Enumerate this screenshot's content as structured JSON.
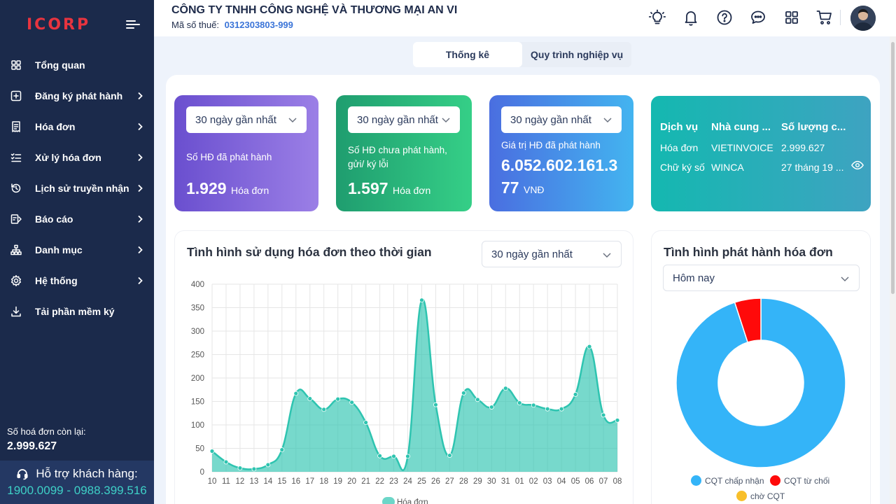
{
  "sidebar": {
    "logo": "ICORP",
    "items": [
      {
        "label": "Tổng quan",
        "icon": "grid-icon",
        "chevron": false
      },
      {
        "label": "Đăng ký phát hành",
        "icon": "plus-square-icon",
        "chevron": true
      },
      {
        "label": "Hóa đơn",
        "icon": "receipt-icon",
        "chevron": true
      },
      {
        "label": "Xử lý hóa đơn",
        "icon": "checklist-icon",
        "chevron": true
      },
      {
        "label": "Lịch sử truyền nhận",
        "icon": "history-icon",
        "chevron": true
      },
      {
        "label": "Báo cáo",
        "icon": "report-icon",
        "chevron": true
      },
      {
        "label": "Danh mục",
        "icon": "sitemap-icon",
        "chevron": true
      },
      {
        "label": "Hệ thống",
        "icon": "gear-icon",
        "chevron": true
      },
      {
        "label": "Tải phần mềm ký",
        "icon": "download-icon",
        "chevron": false
      }
    ],
    "remaining_label": "Số hoá đơn còn lại:",
    "remaining_value": "2.999.627",
    "support_label": "Hỗ trợ khách hàng:",
    "support_phones": "1900.0099 - 0988.399.516"
  },
  "header": {
    "company": "CÔNG TY TNHH CÔNG NGHỆ VÀ THƯƠNG MẠI AN VI",
    "tax_label": "Mã số thuế:",
    "tax_code": "0312303803-999",
    "icons": [
      "lightbulb-icon",
      "bell-icon",
      "help-icon",
      "chat-icon",
      "apps-icon",
      "cart-icon"
    ]
  },
  "tabs": [
    {
      "label": "Thống kê",
      "active": true
    },
    {
      "label": "Quy trình nghiệp vụ",
      "active": false
    }
  ],
  "cards": [
    {
      "period": "30 ngày gần nhất",
      "label": "Số HĐ đã phát hành",
      "value": "1.929",
      "unit": "Hóa đơn",
      "gradient": [
        "#6a4fcf",
        "#9b7fe6"
      ]
    },
    {
      "period": "30 ngày gần nhất",
      "label": "Số HĐ chưa phát hành, gửi/ ký lỗi",
      "value": "1.597",
      "unit": "Hóa đơn",
      "gradient": [
        "#1f9d6f",
        "#35cf87"
      ]
    },
    {
      "period": "30 ngày gần nhất",
      "label": "Giá trị HĐ đã phát hành",
      "value": "6.052.602.161.377",
      "unit": "VNĐ",
      "gradient": [
        "#4a6ee0",
        "#43b4f0"
      ]
    }
  ],
  "service": {
    "headers": [
      "Dịch vụ",
      "Nhà cung ...",
      "Số lượng c..."
    ],
    "rows": [
      [
        "Hóa đơn",
        "VIETINVOICE",
        "2.999.627"
      ],
      [
        "Chữ ký số",
        "WINCA",
        "27 tháng 19 ..."
      ]
    ],
    "icon": "eye-icon"
  },
  "usage_chart": {
    "title": "Tình hình sử dụng hóa đơn theo thời gian",
    "period": "30 ngày gần nhất"
  },
  "chart_data": [
    {
      "type": "area",
      "title": "Tình hình sử dụng hóa đơn theo thời gian",
      "categories": [
        "10",
        "11",
        "12",
        "13",
        "14",
        "15",
        "16",
        "17",
        "18",
        "19",
        "20",
        "21",
        "22",
        "23",
        "24",
        "25",
        "26",
        "27",
        "28",
        "29",
        "30",
        "31",
        "01",
        "02",
        "03",
        "04",
        "05",
        "06",
        "07",
        "08"
      ],
      "series": [
        {
          "name": "Hóa đơn",
          "values": [
            44,
            21,
            8,
            6,
            15,
            47,
            167,
            156,
            133,
            155,
            148,
            105,
            34,
            33,
            33,
            366,
            143,
            35,
            168,
            154,
            138,
            178,
            147,
            142,
            134,
            134,
            165,
            267,
            121,
            110
          ],
          "color": "#2ec4b0"
        }
      ],
      "ylim": [
        0,
        400
      ],
      "yticks": [
        0,
        50,
        100,
        150,
        200,
        250,
        300,
        350,
        400
      ],
      "grid": true,
      "legend": "bottom"
    },
    {
      "type": "pie",
      "title": "Tình hình phát hành hóa đơn",
      "period": "Hôm nay",
      "labels": [
        "CQT chấp nhận",
        "CQT từ chối",
        "chờ CQT"
      ],
      "values": [
        95,
        5,
        0
      ],
      "colors": [
        "#34b4f8",
        "#ff0a0a",
        "#f8bf2a"
      ],
      "legend": "bottom"
    }
  ]
}
